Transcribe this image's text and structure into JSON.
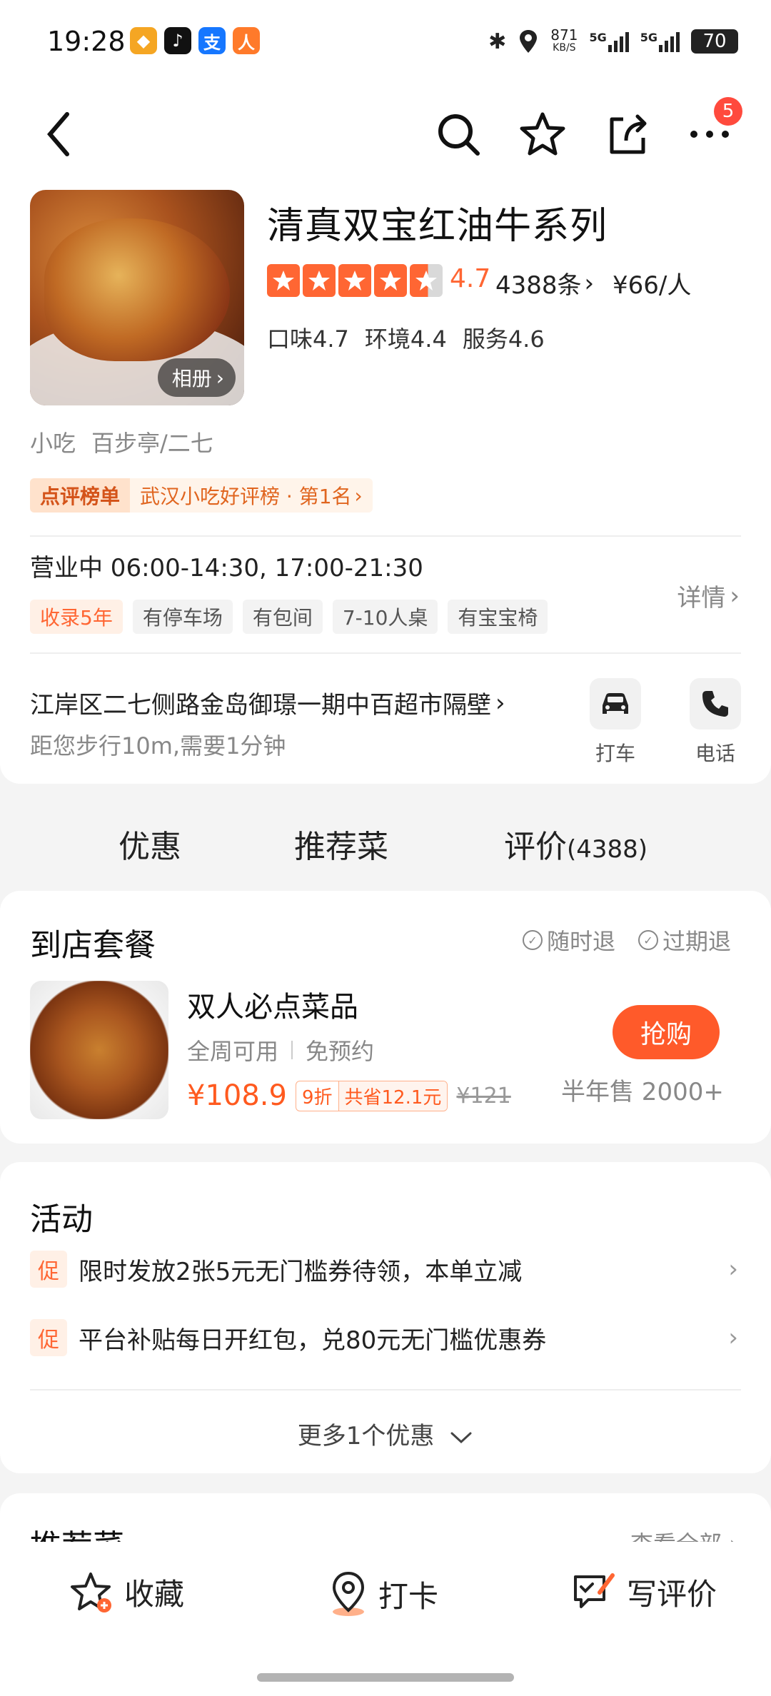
{
  "status_bar": {
    "time": "19:28",
    "net_speed": "871",
    "net_unit": "KB/S",
    "sig1": "5G",
    "sig2": "5G",
    "battery": "70"
  },
  "header": {
    "more_badge": "5"
  },
  "shop": {
    "name": "清真双宝红油牛系列",
    "album_label": "相册",
    "rating": "4.7",
    "review_count": "4388条",
    "price_per_person": "¥66/人",
    "scores": [
      "口味4.7",
      "环境4.4",
      "服务4.6"
    ],
    "category": "小吃",
    "area": "百步亭/二七",
    "rank_tag": "点评榜单",
    "rank_text": "武汉小吃好评榜 · 第1名",
    "hours": "营业中  06:00-14:30, 17:00-21:30",
    "chips": [
      "收录5年",
      "有停车场",
      "有包间",
      "7-10人桌",
      "有宝宝椅"
    ],
    "details_label": "详情",
    "address": "江岸区二七侧路金岛御璟一期中百超市隔壁",
    "distance": "距您步行10m,需要1分钟",
    "taxi_label": "打车",
    "phone_label": "电话"
  },
  "tabs": {
    "deals": "优惠",
    "dishes": "推荐菜",
    "reviews": "评价",
    "reviews_count": "(4388)"
  },
  "package": {
    "title": "到店套餐",
    "refund_any": "随时退",
    "refund_expired": "过期退",
    "deal_name": "双人必点菜品",
    "availability": "全周可用",
    "booking": "免预约",
    "price": "¥108.9",
    "discount": "9折",
    "saving": "共省12.1元",
    "original_price": "¥121",
    "buy_label": "抢购",
    "sold": "半年售 2000+"
  },
  "activity": {
    "title": "活动",
    "promo_tag": "促",
    "items": [
      "限时发放2张5元无门槛券待领，本单立减",
      "平台补贴每日开红包，兑80元无门槛优惠券"
    ],
    "more": "更多1个优惠"
  },
  "recommend": {
    "title": "推荐菜",
    "view_all": "查看全部"
  },
  "bottom_bar": {
    "favorite": "收藏",
    "checkin": "打卡",
    "write_review": "写评价"
  },
  "colors": {
    "accent": "#ff6633",
    "buy": "#ff5a2a",
    "badge": "#ff4a3d"
  }
}
